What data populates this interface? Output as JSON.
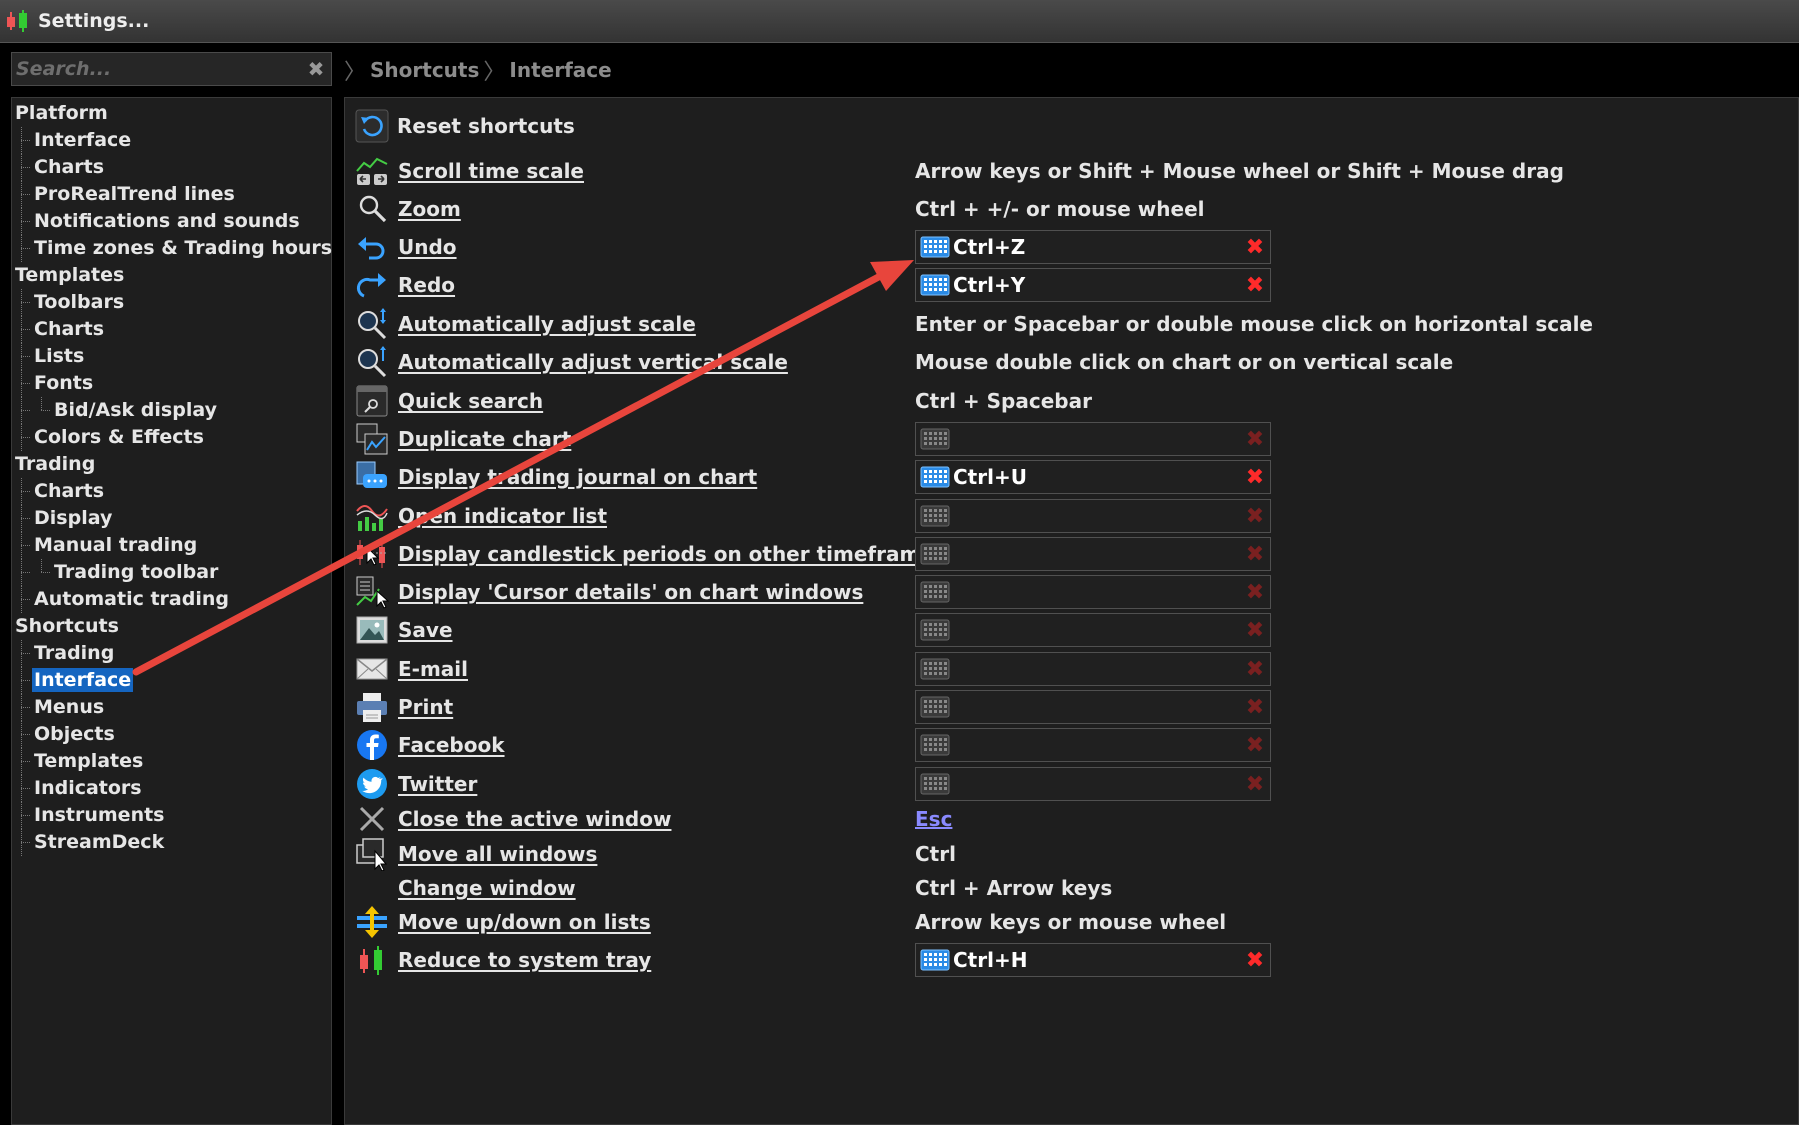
{
  "window": {
    "title": "Settings..."
  },
  "search": {
    "placeholder": "Search..."
  },
  "breadcrumb": [
    "Shortcuts",
    "Interface"
  ],
  "tree": [
    {
      "label": "Platform",
      "level": 0
    },
    {
      "label": "Interface",
      "level": 1
    },
    {
      "label": "Charts",
      "level": 1
    },
    {
      "label": "ProRealTrend lines",
      "level": 1
    },
    {
      "label": "Notifications and sounds",
      "level": 1
    },
    {
      "label": "Time zones & Trading hours",
      "level": 1
    },
    {
      "label": "Templates",
      "level": 0
    },
    {
      "label": "Toolbars",
      "level": 1
    },
    {
      "label": "Charts",
      "level": 1
    },
    {
      "label": "Lists",
      "level": 1
    },
    {
      "label": "Fonts",
      "level": 1
    },
    {
      "label": "Bid/Ask display",
      "level": 2
    },
    {
      "label": "Colors & Effects",
      "level": 1
    },
    {
      "label": "Trading",
      "level": 0
    },
    {
      "label": "Charts",
      "level": 1
    },
    {
      "label": "Display",
      "level": 1
    },
    {
      "label": "Manual trading",
      "level": 1
    },
    {
      "label": "Trading toolbar",
      "level": 2
    },
    {
      "label": "Automatic trading",
      "level": 1
    },
    {
      "label": "Shortcuts",
      "level": 0
    },
    {
      "label": "Trading",
      "level": 1
    },
    {
      "label": "Interface",
      "level": 1,
      "selected": true
    },
    {
      "label": "Menus",
      "level": 1
    },
    {
      "label": "Objects",
      "level": 1
    },
    {
      "label": "Templates",
      "level": 1
    },
    {
      "label": "Indicators",
      "level": 1
    },
    {
      "label": "Instruments",
      "level": 1
    },
    {
      "label": "StreamDeck",
      "level": 1
    }
  ],
  "reset": {
    "label": "Reset shortcuts"
  },
  "shortcuts": [
    {
      "name": "Scroll time scale",
      "icon": "scroll-time-icon",
      "type": "text",
      "value": "Arrow keys or Shift + Mouse wheel or Shift + Mouse drag"
    },
    {
      "name": "Zoom",
      "icon": "zoom-icon",
      "type": "text",
      "value": "Ctrl + +/- or mouse wheel"
    },
    {
      "name": "Undo",
      "icon": "undo-icon",
      "type": "key",
      "value": "Ctrl+Z"
    },
    {
      "name": "Redo",
      "icon": "redo-icon",
      "type": "key",
      "value": "Ctrl+Y"
    },
    {
      "name": "Automatically adjust scale",
      "icon": "auto-scale-icon",
      "type": "text",
      "value": "Enter or Spacebar or double mouse click on horizontal scale"
    },
    {
      "name": "Automatically adjust vertical scale",
      "icon": "auto-vertical-scale-icon",
      "type": "text",
      "value": "Mouse double click on chart or on vertical scale"
    },
    {
      "name": "Quick search",
      "icon": "quick-search-icon",
      "type": "text",
      "value": "Ctrl + Spacebar"
    },
    {
      "name": "Duplicate chart",
      "icon": "duplicate-chart-icon",
      "type": "key",
      "value": ""
    },
    {
      "name": "Display trading journal on chart",
      "icon": "trading-journal-icon",
      "type": "key",
      "value": "Ctrl+U"
    },
    {
      "name": "Open indicator list",
      "icon": "indicator-list-icon",
      "type": "key",
      "value": ""
    },
    {
      "name": "Display candlestick periods on other timeframes",
      "icon": "candlestick-periods-icon",
      "type": "key",
      "value": ""
    },
    {
      "name": "Display 'Cursor details' on chart windows",
      "icon": "cursor-details-icon",
      "type": "key",
      "value": ""
    },
    {
      "name": "Save",
      "icon": "save-image-icon",
      "type": "key",
      "value": ""
    },
    {
      "name": "E-mail",
      "icon": "email-icon",
      "type": "key",
      "value": ""
    },
    {
      "name": "Print",
      "icon": "printer-icon",
      "type": "key",
      "value": ""
    },
    {
      "name": "Facebook",
      "icon": "facebook-icon",
      "type": "key",
      "value": ""
    },
    {
      "name": "Twitter",
      "icon": "twitter-icon",
      "type": "key",
      "value": ""
    },
    {
      "name": "Close the active window",
      "icon": "close-window-icon",
      "type": "link",
      "value": "Esc"
    },
    {
      "name": "Move all windows",
      "icon": "move-windows-icon",
      "type": "text",
      "value": "Ctrl"
    },
    {
      "name": "Change window",
      "icon": "",
      "type": "text",
      "value": "Ctrl + Arrow keys"
    },
    {
      "name": "Move up/down on lists",
      "icon": "move-up-down-icon",
      "type": "text",
      "value": "Arrow keys or mouse wheel"
    },
    {
      "name": "Reduce to system tray",
      "icon": "system-tray-icon",
      "type": "key",
      "value": "Ctrl+H"
    }
  ],
  "colors": {
    "selection": "#1565c0",
    "delete_active": "#ff2a2a",
    "annotation_arrow": "#e8453c",
    "link": "#8a8aff"
  }
}
